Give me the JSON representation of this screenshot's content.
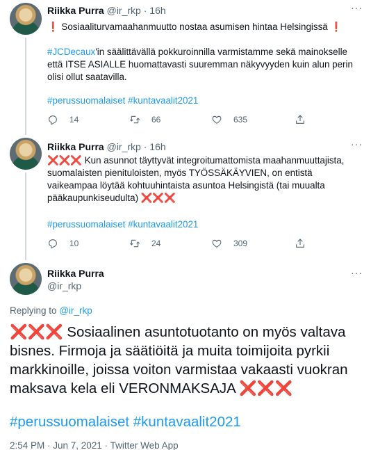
{
  "tweet1": {
    "name": "Riikka Purra",
    "handle": "@ir_rkp",
    "dot": "·",
    "time": "16h",
    "more": "···",
    "line1_mark": "❗",
    "line1_text": " Sosiaaliturvamaahanmuutto nostaa asumisen hintaa Helsingissä ",
    "line1_mark_end": "❗",
    "para2_link": "#JCDecaux",
    "para2_text": "'in säälittävällä pokkuroinnilla varmistamme sekä mainokselle että ITSE ASIALLE huomattavasti suuremman näkyvyyden kuin alun perin olisi ollut saatavilla.",
    "hashtags": "#perussuomalaiset #kuntavaalit2021",
    "replies": "14",
    "retweets": "66",
    "likes": "635"
  },
  "tweet2": {
    "name": "Riikka Purra",
    "handle": "@ir_rkp",
    "dot": "·",
    "time": "16h",
    "more": "···",
    "x_start": "❌❌❌",
    "text": " Kun asunnot täyttyvät integroitumattomista maahanmuuttajista, suomalaisten pienituloisten, myös TYÖSSÄKÄYVIEN, on entistä vaikeampaa löytää kohtuuhintaista asuntoa Helsingistä (tai muualta pääkaupunkiseudulta) ",
    "x_end": "❌❌❌",
    "hashtags": "#perussuomalaiset #kuntavaalit2021",
    "replies": "10",
    "retweets": "24",
    "likes": "309"
  },
  "main": {
    "name": "Riikka Purra",
    "handle": "@ir_rkp",
    "more": "···",
    "replying_prefix": "Replying to ",
    "replying_handle": "@ir_rkp",
    "x_start": "❌❌❌",
    "text": " Sosiaalinen asuntotuotanto on myös valtava bisnes. Firmoja ja säätiöitä ja muita toimijoita pyrkii markkinoille, joissa voiton varmistaa vakaasti vuokran maksava kela eli VERONMAKSAJA ",
    "x_end": "❌❌❌",
    "hashtags": "#perussuomalaiset #kuntavaalit2021",
    "meta": "2:54 PM · Jun 7, 2021 · Twitter Web App"
  },
  "colors": {
    "link": "#1d9bf0",
    "muted": "#536471",
    "text": "#0f1419",
    "cross": "#e01e3c"
  },
  "icons": [
    "reply-icon",
    "retweet-icon",
    "like-icon",
    "share-icon",
    "more-icon"
  ]
}
